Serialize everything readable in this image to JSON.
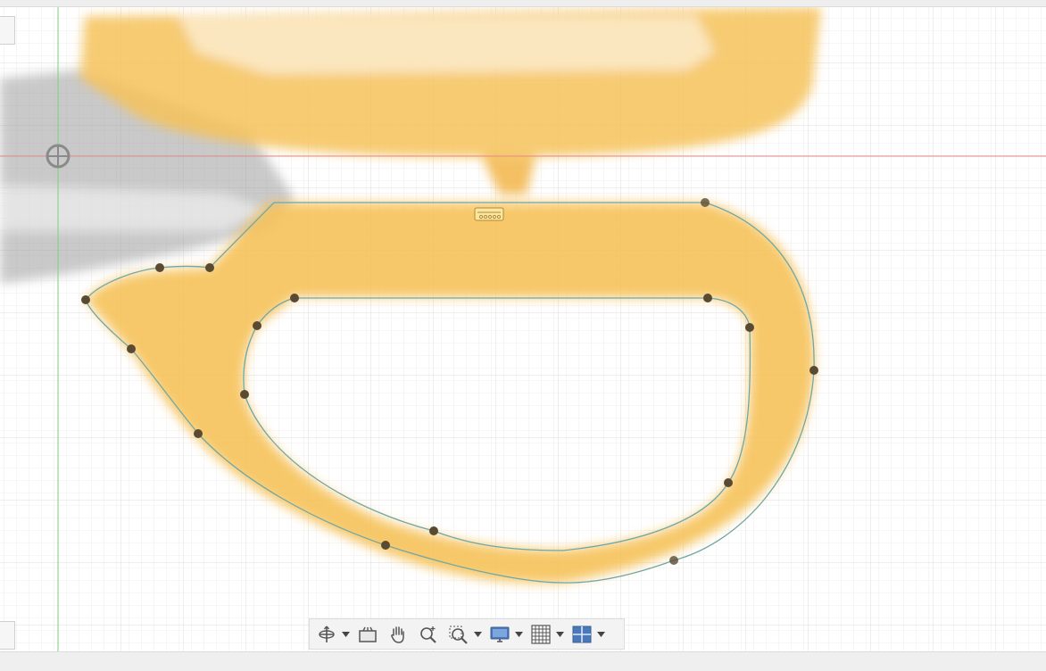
{
  "window": {
    "bg_color": "#ffffff",
    "chrome_color": "#efefef"
  },
  "canvas": {
    "grid_color": "#e6e6e6",
    "x_axis_color": "#e58a8a",
    "y_axis_color": "#7ccf7c",
    "body_fill": "#f6c25a",
    "sketch_line_color": "#6fa7a6",
    "point_color": "#5a4a32"
  },
  "toolbar": {
    "items": [
      {
        "name": "orbit-icon",
        "has_dropdown": true
      },
      {
        "name": "look-at-icon",
        "has_dropdown": false
      },
      {
        "name": "pan-hand-icon",
        "has_dropdown": false
      },
      {
        "name": "zoom-icon",
        "has_dropdown": false
      },
      {
        "name": "zoom-window-icon",
        "has_dropdown": true
      },
      {
        "name": "display-settings-icon",
        "has_dropdown": true
      },
      {
        "name": "grid-snap-icon",
        "has_dropdown": true
      },
      {
        "name": "viewports-icon",
        "has_dropdown": true
      }
    ]
  }
}
